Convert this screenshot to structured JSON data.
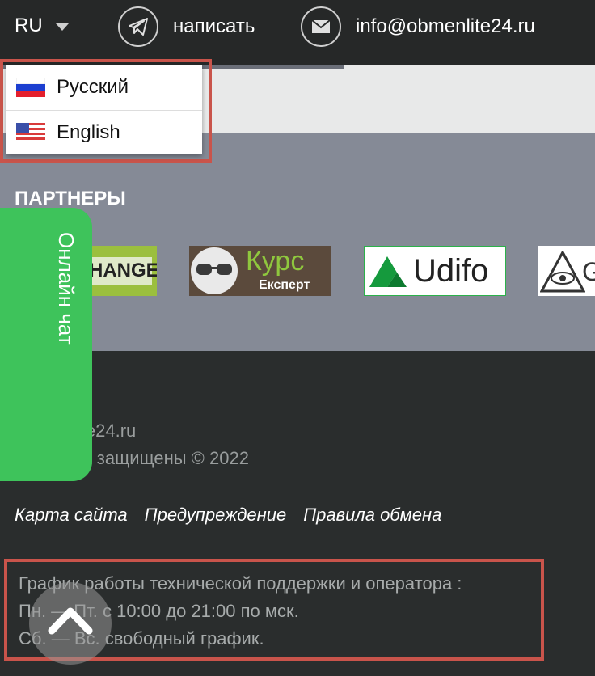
{
  "header": {
    "lang_current": "RU",
    "write_label": "написать",
    "email": "info@obmenlite24.ru"
  },
  "lang_menu": {
    "items": [
      {
        "label": "Русский",
        "flag": "ru-flag-icon"
      },
      {
        "label": "English",
        "flag": "us-flag-icon"
      }
    ]
  },
  "partners": {
    "title": "ПАРТНЕРЫ",
    "logos": [
      {
        "text": "HANGE"
      },
      {
        "text_main": "Курс",
        "text_sub": "Експерт"
      },
      {
        "text": "Udifo"
      },
      {
        "text": "G"
      }
    ]
  },
  "chat": {
    "label": "Онлайн чат"
  },
  "footer": {
    "site_partial": "lite24.ru",
    "rights_partial": "ва защищены © 2022",
    "links": [
      "Карта сайта",
      "Предупреждение",
      "Правила обмена"
    ],
    "schedule": [
      "График работы технической поддержки и оператора :",
      "Пн. — Пт. с 10:00 до 21:00 по мск.",
      "Сб. — Вс. свободный график."
    ]
  },
  "colors": {
    "topbar": "#262828",
    "partners_bg": "#858a96",
    "footer_bg": "#2a2d2d",
    "chat_green": "#3ec35b",
    "highlight_red": "#c9544b"
  }
}
